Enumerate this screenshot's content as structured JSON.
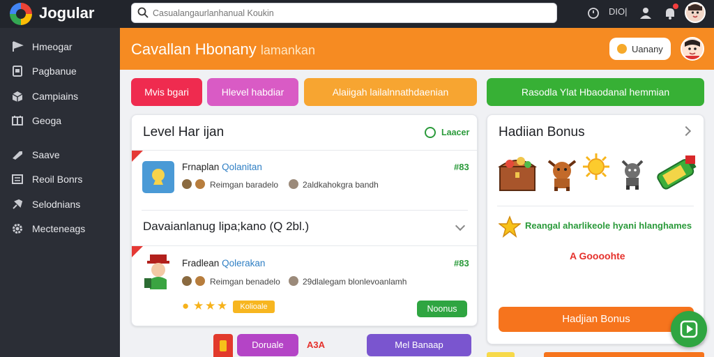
{
  "app": {
    "logo_text": "Jogular"
  },
  "search": {
    "placeholder": "Casualangaurlanhanual Koukin"
  },
  "topbar": {
    "label": "DIO|",
    "icons": [
      "clock-icon",
      "person-icon",
      "bell-icon"
    ]
  },
  "sidebar": {
    "items": [
      {
        "label": "Hmeogar",
        "icon": "flag-icon"
      },
      {
        "label": "Pagbanue",
        "icon": "file-icon"
      },
      {
        "label": "Campiains",
        "icon": "box-icon"
      },
      {
        "label": "Geoga",
        "icon": "grid-icon"
      },
      {
        "label": "Saave",
        "icon": "megaphone-icon"
      },
      {
        "label": "Reoil Bonrs",
        "icon": "list-icon"
      },
      {
        "label": "Selodnians",
        "icon": "pin-icon"
      },
      {
        "label": "Mecteneags",
        "icon": "gear-icon"
      }
    ]
  },
  "header": {
    "title": "Cavallan Hbonany",
    "subtitle": "lamankan",
    "button_label": "Uanany"
  },
  "actions": {
    "pills": [
      {
        "label": "Mvis bgari",
        "color": "#ef2b4f"
      },
      {
        "label": "Hlevel habdiar",
        "color": "#d95bc5"
      },
      {
        "label": "Alaiigah lailalnnathdaenian",
        "color": "#f7a531"
      },
      {
        "label": "Rasodla Ylat Hbaodanal hemmian",
        "color": "#37b035"
      }
    ]
  },
  "level_card": {
    "title": "Level Har ijan",
    "badge": "Laacer",
    "row1": {
      "title": "Frnaplan",
      "title_highlight": "Qolanitan",
      "meta_a": "Reimgan baradelo",
      "meta_b": "2aldkahokgra bandh",
      "points": "83"
    },
    "section_title": "Davaianlanug lipa;kano (Q 2bl.)",
    "row2": {
      "title": "Fradlean",
      "title_highlight": "Qolerakan",
      "meta_a": "Reimgan benadelo",
      "meta_b": "29dlalegam blonlevoanlamh",
      "points": "83",
      "tag": "Kolioale",
      "action_label": "Noonus"
    }
  },
  "bonus_card": {
    "title": "Hadiian Bonus",
    "reward_text": "Reangal aharlikeole hyani hlanghames",
    "reward_sub": "A Goooohte",
    "button_label": "Hadjian Bonus",
    "reward_icons": [
      "treasure-chest-icon",
      "bull-icon",
      "sun-icon",
      "wolf-icon",
      "battery-icon"
    ]
  },
  "bottom": {
    "btn1": "Doruale",
    "btn1_value": "A3A",
    "btn2": "Mel Banaap"
  },
  "colors": {
    "accent": "#f68b22",
    "green": "#2fa541",
    "sidebar": "#2b2e36",
    "topbar": "#22252c"
  }
}
